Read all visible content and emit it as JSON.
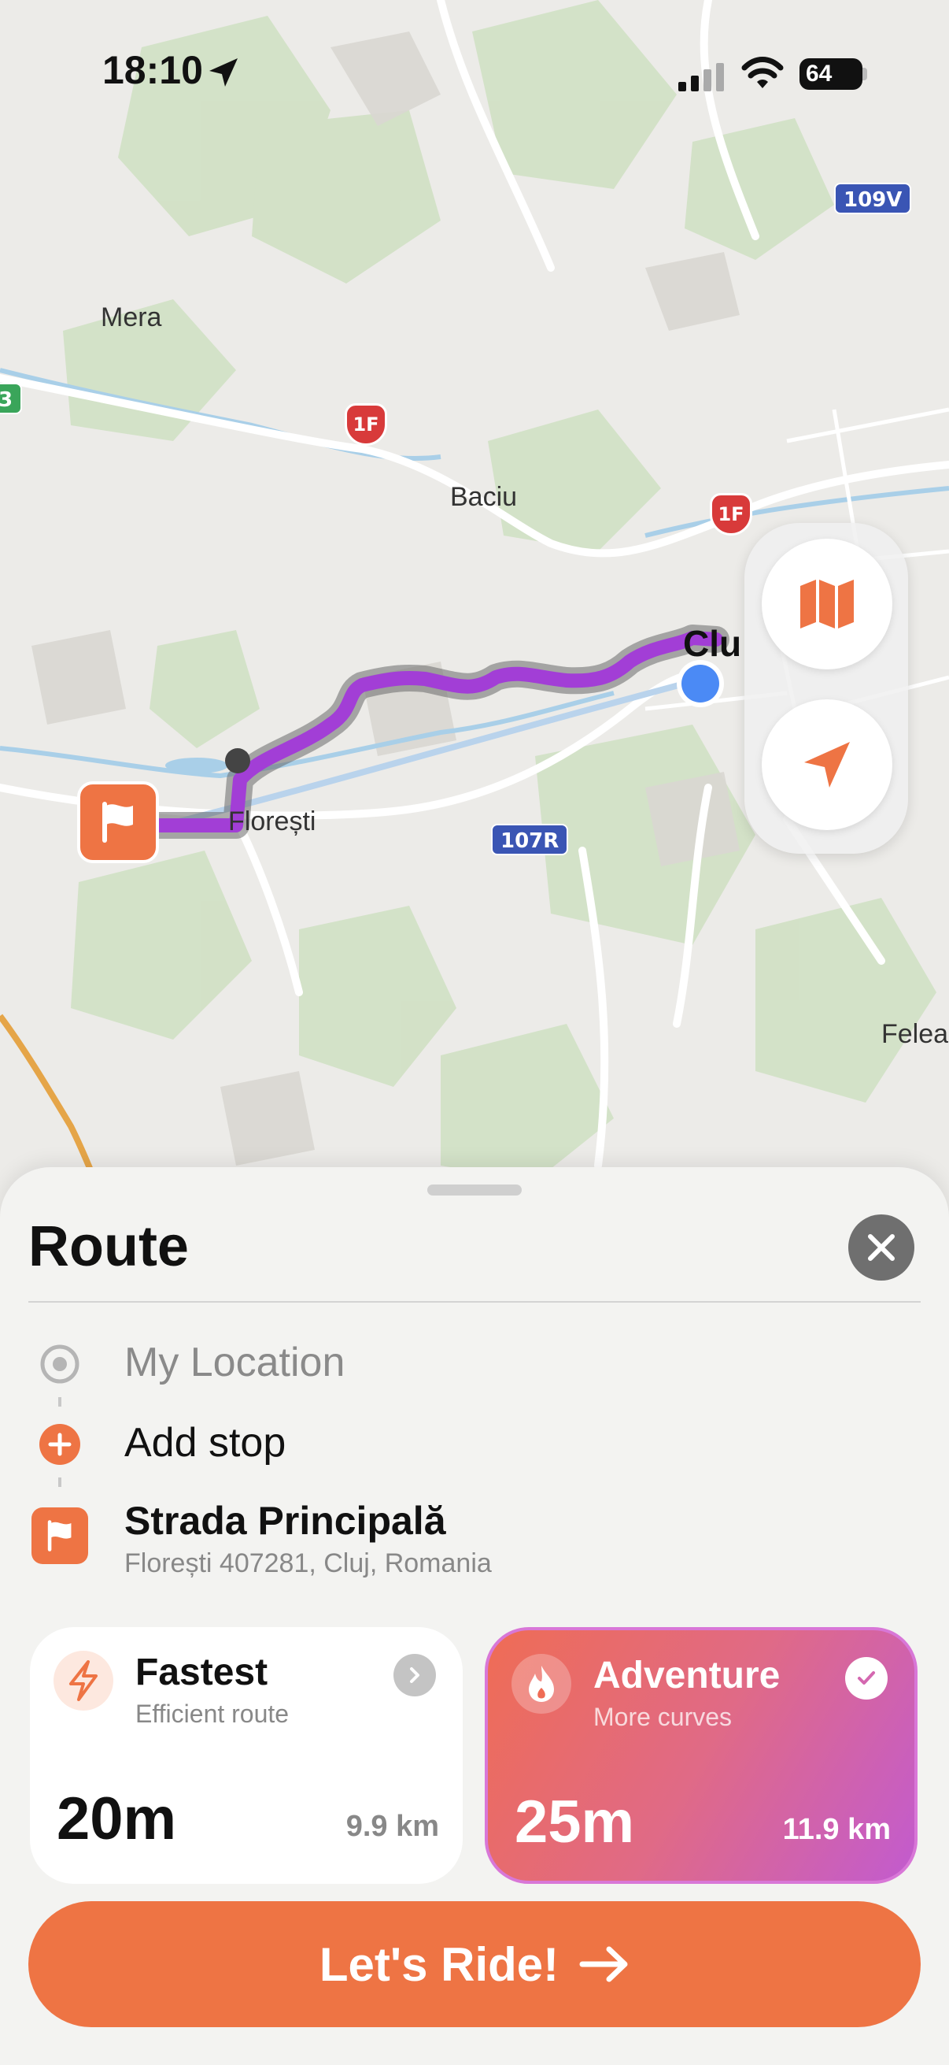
{
  "status_bar": {
    "time": "18:10",
    "battery": "64"
  },
  "map": {
    "places": {
      "mera": "Mera",
      "baciu": "Baciu",
      "cluj": "Clu",
      "floresti": "Florești",
      "felea": "Felea"
    },
    "road_shields": {
      "r109v": "109V",
      "r1f_a": "1F",
      "r1f_b": "1F",
      "r107r": "107R",
      "r3": "3"
    },
    "route_color": "#a23ed6",
    "user_location_color": "#4b8af5"
  },
  "sheet": {
    "title": "Route",
    "origin": "My Location",
    "add_stop": "Add stop",
    "destination_name": "Strada Principală",
    "destination_address": "Florești 407281, Cluj, Romania"
  },
  "routes": {
    "fastest": {
      "title": "Fastest",
      "subtitle": "Efficient route",
      "time": "20m",
      "distance": "9.9 km",
      "icon": "lightning-icon",
      "selected": false
    },
    "adventure": {
      "title": "Adventure",
      "subtitle": "More curves",
      "time": "25m",
      "distance": "11.9 km",
      "icon": "flame-icon",
      "selected": true
    }
  },
  "cta": {
    "label": "Let's Ride!"
  },
  "colors": {
    "accent": "#ee7444",
    "adventure_gradient": [
      "#ef6c55",
      "#c25bcf"
    ]
  }
}
